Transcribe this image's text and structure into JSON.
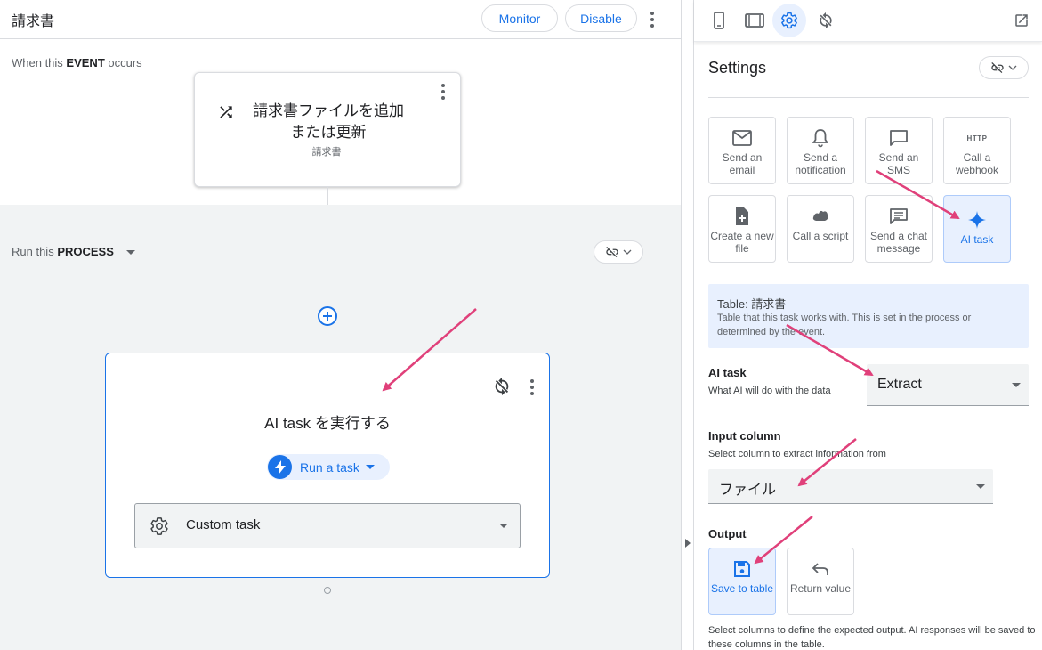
{
  "app": {
    "title": "請求書",
    "monitor_label": "Monitor",
    "disable_label": "Disable"
  },
  "event": {
    "label_prefix": "When this ",
    "label_bold": "EVENT",
    "label_suffix": " occurs",
    "card_title": "請求書ファイルを追加または更新",
    "card_subtitle": "請求書"
  },
  "process": {
    "label_prefix": "Run this ",
    "label_bold": "PROCESS",
    "task_title": "AI task を実行する",
    "run_chip_label": "Run a task",
    "custom_task_label": "Custom task"
  },
  "settings": {
    "title": "Settings",
    "toolbar_icons": [
      "phone-icon",
      "tablet-icon",
      "gear-icon",
      "sync-icon",
      "open-in-new-icon"
    ],
    "active_toolbar_icon": "gear-icon",
    "tiles": [
      {
        "label": "Send an email",
        "icon": "mail-icon",
        "selected": false
      },
      {
        "label": "Send a notification",
        "icon": "bell-icon",
        "selected": false
      },
      {
        "label": "Send an SMS",
        "icon": "sms-icon",
        "selected": false
      },
      {
        "label": "Call a webhook",
        "icon": "http-icon",
        "icon_text": "HTTP",
        "selected": false
      },
      {
        "label": "Create a new file",
        "icon": "file-add-icon",
        "selected": false
      },
      {
        "label": "Call a script",
        "icon": "script-icon",
        "selected": false
      },
      {
        "label": "Send a chat message",
        "icon": "chat-icon",
        "selected": false
      },
      {
        "label": "AI task",
        "icon": "sparkle-icon",
        "selected": true
      }
    ],
    "table_info": {
      "title": "Table: 請求書",
      "description": "Table that this task works with. This is set in the process or determined by the event."
    },
    "ai_task": {
      "label": "AI task",
      "help": "What AI will do with the data",
      "value": "Extract"
    },
    "input_column": {
      "label": "Input column",
      "help": "Select column to extract information from",
      "value": "ファイル"
    },
    "output": {
      "label": "Output",
      "options": [
        {
          "label": "Save to table",
          "icon": "save-icon",
          "selected": true
        },
        {
          "label": "Return value",
          "icon": "return-icon",
          "selected": false
        }
      ],
      "note": "Select columns to define the expected output. AI responses will be saved to these columns in the table."
    }
  },
  "colors": {
    "accent": "#1a73e8",
    "selected_bg": "#e8f0fe",
    "annotation_arrow": "#e0407a",
    "process_bg": "#f1f3f4"
  }
}
